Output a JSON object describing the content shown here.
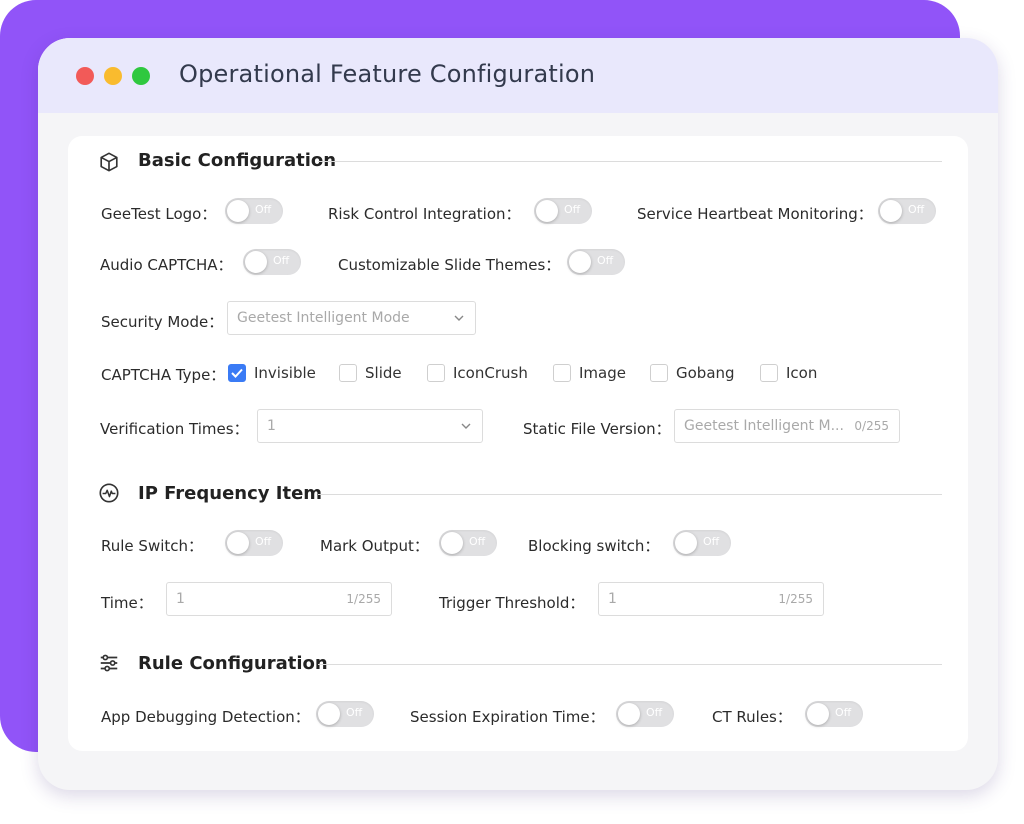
{
  "window": {
    "title": "Operational Feature Configuration"
  },
  "toggle_off_text": "Off",
  "colors": {
    "accent_purple": "#9154f8",
    "titlebar": "#e9e8fc",
    "checkbox_blue": "#3a7bf5"
  },
  "basic": {
    "title": "Basic Configuration",
    "geetest_logo": "GeeTest Logo：",
    "risk_control": "Risk Control Integration：",
    "heartbeat": "Service Heartbeat Monitoring：",
    "audio_captcha": "Audio CAPTCHA：",
    "slide_themes": "Customizable Slide Themes：",
    "security_mode_label": "Security Mode：",
    "security_mode_value": "Geetest Intelligent Mode",
    "captcha_type_label": "CAPTCHA Type：",
    "captcha_types": [
      {
        "label": "Invisible",
        "checked": true
      },
      {
        "label": "Slide",
        "checked": false
      },
      {
        "label": "IconCrush",
        "checked": false
      },
      {
        "label": "Image",
        "checked": false
      },
      {
        "label": "Gobang",
        "checked": false
      },
      {
        "label": "Icon",
        "checked": false
      }
    ],
    "verification_times_label": "Verification Times：",
    "verification_times_value": "1",
    "static_file_label": "Static File Version：",
    "static_file_placeholder": "Geetest Intelligent M...",
    "static_file_count": "0/255"
  },
  "ip": {
    "title": "IP Frequency Item",
    "rule_switch": "Rule Switch：",
    "mark_output": "Mark Output：",
    "blocking_switch": "Blocking switch：",
    "time_label": "Time：",
    "time_value": "1",
    "time_count": "1/255",
    "trigger_label": "Trigger Threshold：",
    "trigger_value": "1",
    "trigger_count": "1/255"
  },
  "rule": {
    "title": "Rule Configuration",
    "app_debugging": "App Debugging Detection：",
    "session_expiration": "Session Expiration Time：",
    "ct_rules": "CT Rules："
  }
}
